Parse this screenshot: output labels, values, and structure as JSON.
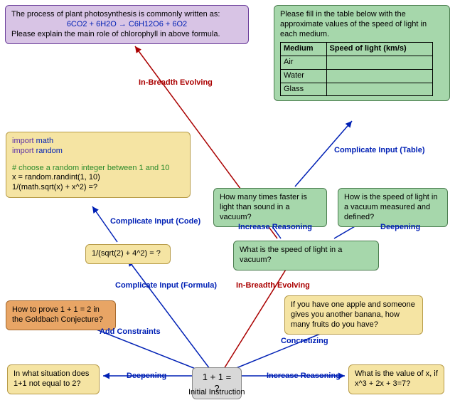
{
  "purple": {
    "line1": "The process of plant photosynthesis is commonly written as:",
    "formula": "6CO2 + 6H2O → C6H12O6 + 6O2",
    "line3": "Please explain the main role of chlorophyll in above formula."
  },
  "table": {
    "prompt": "Please fill in the table below with the approximate values of the speed of light in each medium.",
    "h1": "Medium",
    "h2": "Speed of light (km/s)",
    "r1": "Air",
    "r2": "Water",
    "r3": "Glass"
  },
  "code": {
    "kw_import": "import",
    "mod_math": "math",
    "mod_random": "random",
    "comment": "# choose a random integer between 1 and 10",
    "l1": "x = random.randint(1, 10)",
    "l2": "1/(math.sqrt(x) + x^2) =?"
  },
  "green": {
    "faster": "How many times faster is light than sound in a vacuum?",
    "defined": "How is the speed of light in a vacuum measured and defined?",
    "speed": "What is the speed of light in a vacuum?"
  },
  "yellow": {
    "formula": "1/(sqrt(2) + 4^2) = ?",
    "fruit": "If you have one apple and someone gives you another banana, how many fruits do you have?",
    "situation": "In what situation does 1+1 not equal to 2?",
    "cubic": "What is the value of x, if x^3 + 2x + 3=7?"
  },
  "orange": {
    "goldbach": "How to prove 1 + 1 = 2 in the Goldbach Conjecture?"
  },
  "root": {
    "label": "1 + 1 = ?"
  },
  "rootCaption": "Initial Instruction",
  "edges": {
    "breadth1": "In-Breadth Evolving",
    "breadth2": "In-Breadth Evolving",
    "compTable": "Complicate Input (Table)",
    "compCode": "Complicate Input (Code)",
    "compFormula": "Complicate Input (Formula)",
    "incReason1": "Increase Reasoning",
    "incReason2": "Increase Reasoning",
    "deep1": "Deepening",
    "deep2": "Deepening",
    "addCon": "Add Constraints",
    "concret": "Concretizing"
  }
}
